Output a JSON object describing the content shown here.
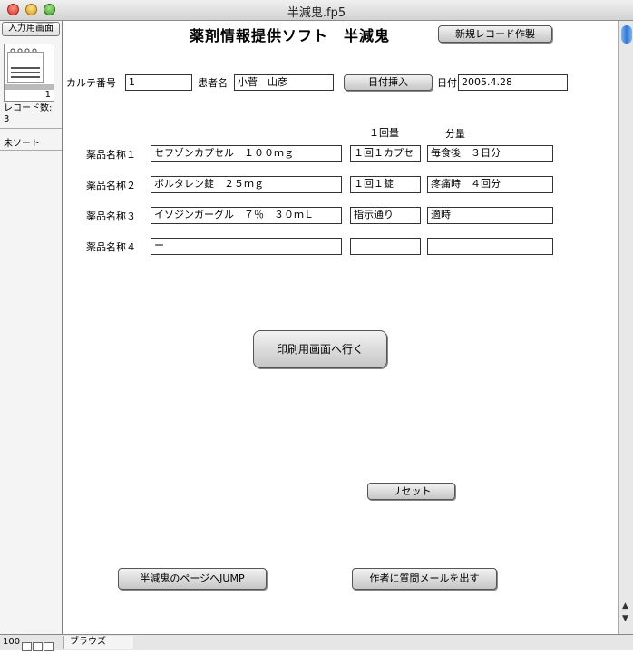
{
  "window": {
    "title": "半減鬼.fp5"
  },
  "status_area": {
    "layout_popup": "入力用画面",
    "record_number": "1",
    "records_label": "レコード数:",
    "records_count": "3",
    "sort_status": "未ソート"
  },
  "bottom_bar": {
    "zoom": "100",
    "mode": "ブラウズ"
  },
  "header": {
    "app_title": "薬剤情報提供ソフト　半減鬼",
    "new_record_button": "新規レコード作製"
  },
  "patient": {
    "chart_no_label": "カルテ番号",
    "chart_no_value": "1",
    "name_label": "患者名",
    "name_value": "小菅　山彦",
    "insert_date_button": "日付挿入",
    "date_label": "日付",
    "date_value": "2005.4.28"
  },
  "drugs": {
    "dose_header": "１回量",
    "amount_header": "分量",
    "rows": [
      {
        "label": "薬品名称１",
        "name": "セフゾンカプセル　１００ｍｇ",
        "dose": "１回１カプセ",
        "amount": "毎食後　３日分"
      },
      {
        "label": "薬品名称２",
        "name": "ボルタレン錠　２５ｍｇ",
        "dose": "１回１錠",
        "amount": "疼痛時　４回分"
      },
      {
        "label": "薬品名称３",
        "name": "イソジンガーグル　７％　３０ｍＬ",
        "dose": "指示通り",
        "amount": "適時"
      },
      {
        "label": "薬品名称４",
        "name": "ー",
        "dose": "",
        "amount": ""
      }
    ]
  },
  "actions": {
    "print_button": "印刷用画面へ行く",
    "reset_button": "リセット",
    "jump_button": "半減鬼のページへJUMP",
    "mail_button": "作者に質問メールを出す"
  }
}
